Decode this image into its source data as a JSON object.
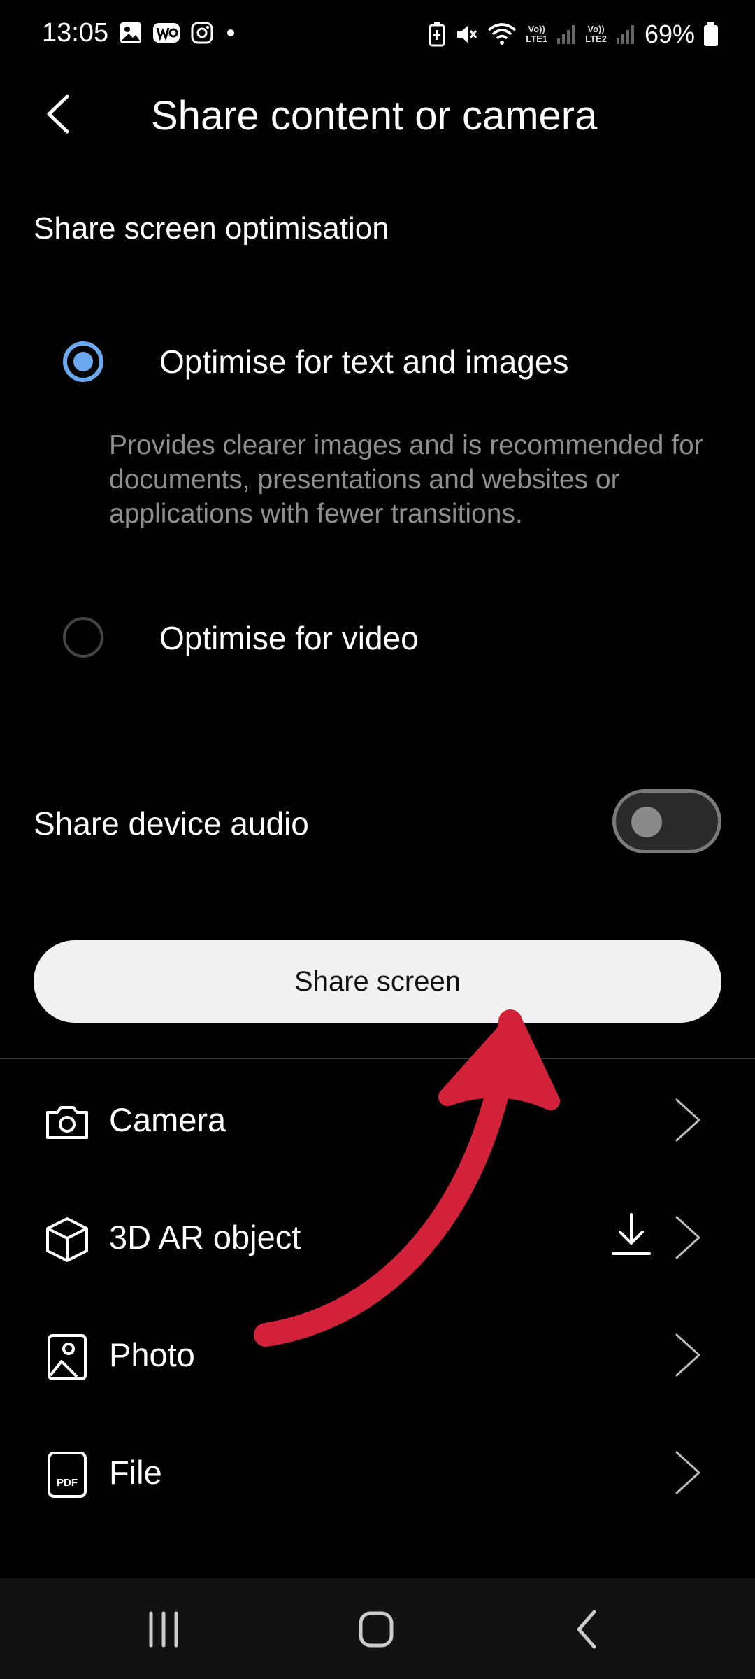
{
  "status_bar": {
    "time": "13:05",
    "lte1": "Vo))\nLTE1",
    "lte2": "Vo))\nLTE2",
    "battery": "69%"
  },
  "header": {
    "title": "Share content or camera"
  },
  "optimisation": {
    "section_title": "Share screen optimisation",
    "option_text_images": {
      "label": "Optimise for text and images",
      "selected": true,
      "description": "Provides clearer images and is recommended for documents, presentations and websites or applications with fewer transitions."
    },
    "option_video": {
      "label": "Optimise for video",
      "selected": false
    }
  },
  "audio": {
    "label": "Share device audio",
    "enabled": false
  },
  "share_button": {
    "label": "Share screen"
  },
  "sources": [
    {
      "label": "Camera",
      "icon": "camera-icon"
    },
    {
      "label": "3D AR object",
      "icon": "cube-icon"
    },
    {
      "label": "Photo",
      "icon": "photo-icon"
    },
    {
      "label": "File",
      "icon": "pdf-file-icon"
    }
  ],
  "colors": {
    "accent": "#6aa8f0",
    "annotation_arrow": "#d4213a",
    "background": "#000000"
  }
}
